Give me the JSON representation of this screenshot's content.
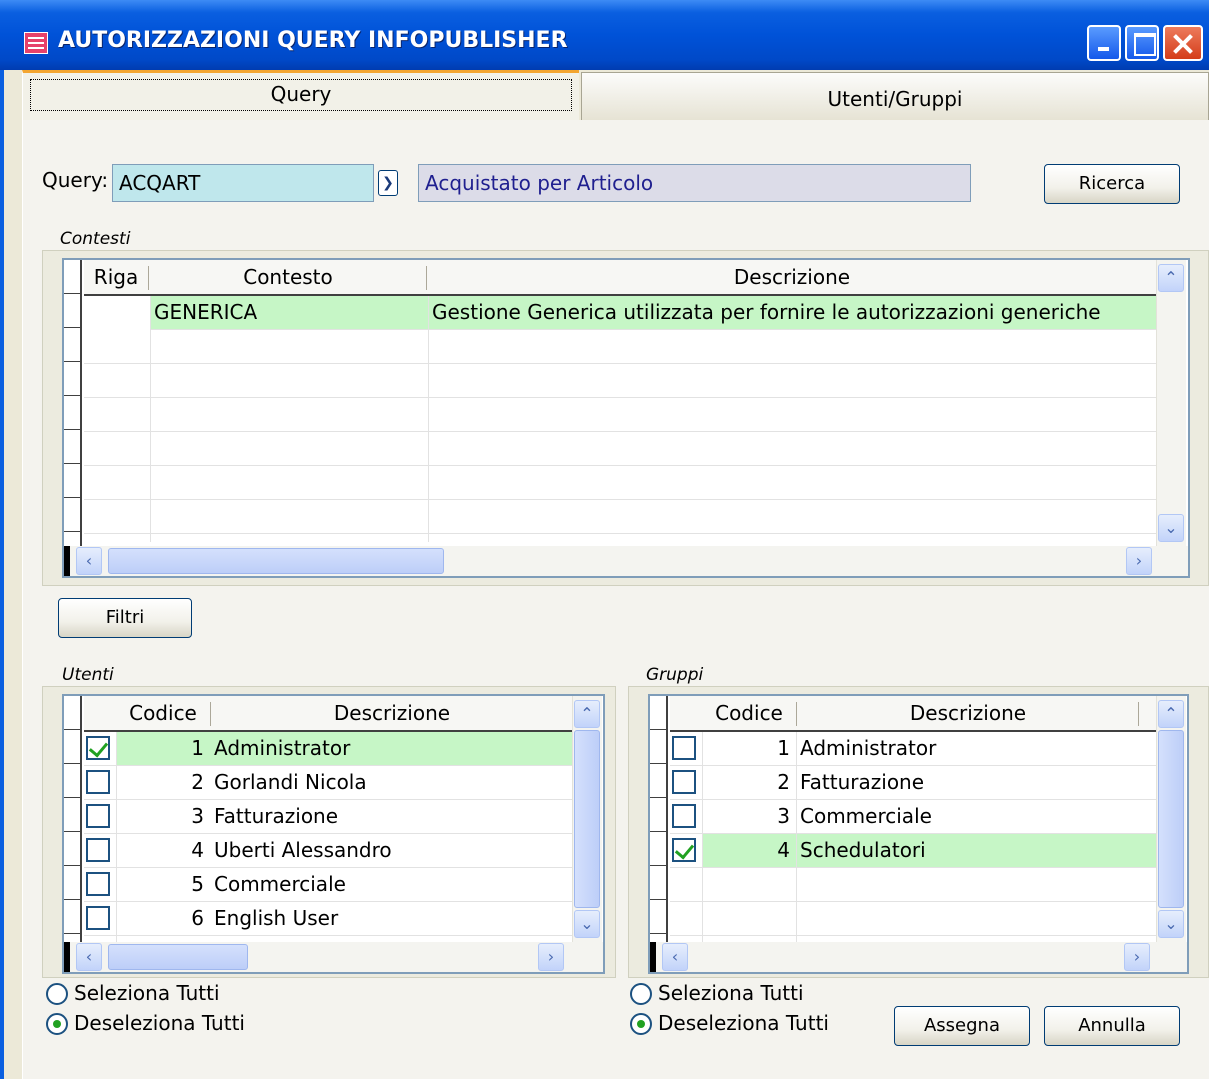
{
  "window": {
    "title": "AUTORIZZAZIONI QUERY INFOPUBLISHER"
  },
  "tabs": [
    {
      "label": "Query"
    },
    {
      "label": "Utenti/Gruppi"
    }
  ],
  "query": {
    "label": "Query:",
    "code": "ACQART",
    "description": "Acquistato per Articolo",
    "search_button": "Ricerca"
  },
  "contesti": {
    "label": "Contesti",
    "columns": [
      "Riga",
      "Contesto",
      "Descrizione"
    ],
    "rows": [
      {
        "riga": "",
        "contesto": "GENERICA",
        "descrizione": "Gestione Generica utilizzata per fornire le autorizzazioni generiche",
        "selected": true
      }
    ]
  },
  "filter_button": "Filtri",
  "utenti": {
    "label": "Utenti",
    "columns": [
      "Codice",
      "Descrizione"
    ],
    "rows": [
      {
        "codice": "1",
        "descrizione": "Administrator",
        "checked": true
      },
      {
        "codice": "2",
        "descrizione": "Gorlandi Nicola",
        "checked": false
      },
      {
        "codice": "3",
        "descrizione": "Fatturazione",
        "checked": false
      },
      {
        "codice": "4",
        "descrizione": "Uberti Alessandro",
        "checked": false
      },
      {
        "codice": "5",
        "descrizione": "Commerciale",
        "checked": false
      },
      {
        "codice": "6",
        "descrizione": "English User",
        "checked": false
      }
    ],
    "select_all": "Seleziona Tutti",
    "deselect_all": "Deseleziona Tutti",
    "selected_option": "deselect_all"
  },
  "gruppi": {
    "label": "Gruppi",
    "columns": [
      "Codice",
      "Descrizione"
    ],
    "rows": [
      {
        "codice": "1",
        "descrizione": "Administrator",
        "checked": false
      },
      {
        "codice": "2",
        "descrizione": "Fatturazione",
        "checked": false
      },
      {
        "codice": "3",
        "descrizione": "Commerciale",
        "checked": false
      },
      {
        "codice": "4",
        "descrizione": "Schedulatori",
        "checked": true
      }
    ],
    "select_all": "Seleziona Tutti",
    "deselect_all": "Deseleziona Tutti",
    "selected_option": "deselect_all"
  },
  "buttons": {
    "assign": "Assegna",
    "cancel": "Annulla"
  },
  "colors": {
    "title_bar": "#0052d8",
    "selected_row": "#c6f6c6",
    "query_field": "#bfe7ec",
    "desc_field": "#dcdce8",
    "tab_accent": "#f3a530"
  }
}
